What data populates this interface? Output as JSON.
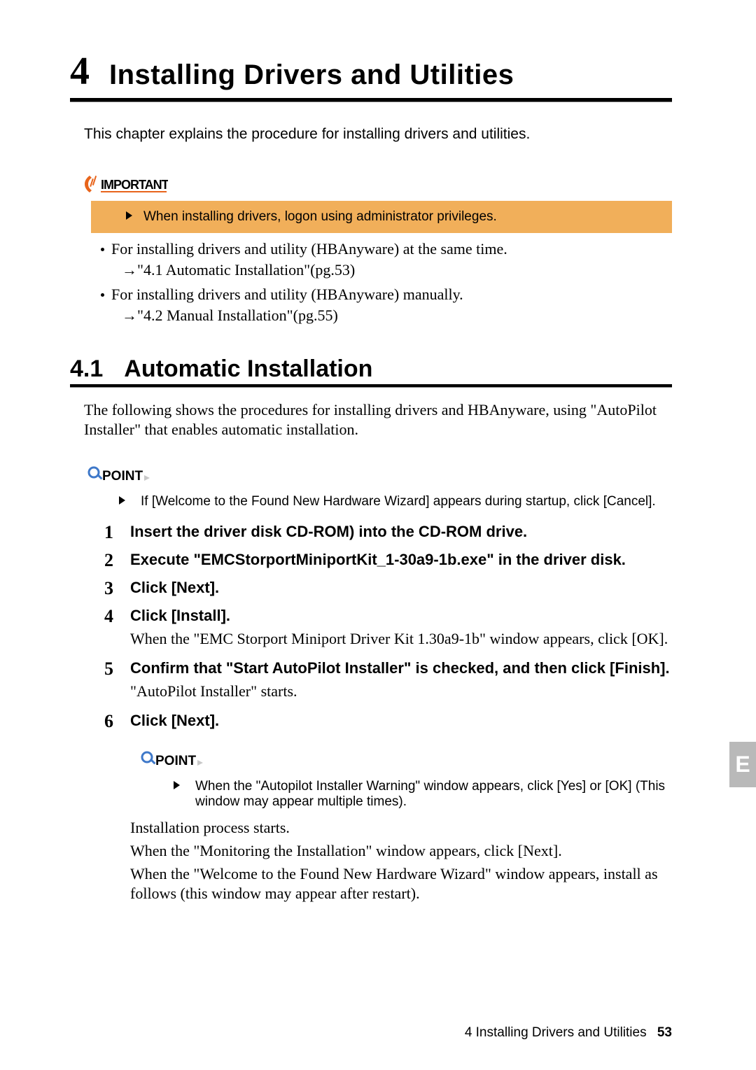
{
  "chapter": {
    "number": "4",
    "title": "Installing Drivers and Utilities",
    "description": "This chapter explains the procedure for installing drivers and utilities."
  },
  "important": {
    "label": "IMPORTANT",
    "text": "When installing drivers, logon using administrator privileges."
  },
  "notes": {
    "n1_line1": "For installing drivers and utility (HBAnyware) at the same time.",
    "n1_line2": "→\"4.1 Automatic Installation\"(pg.53)",
    "n2_line1": "For installing drivers and utility (HBAnyware) manually.",
    "n2_line2": "→\"4.2 Manual Installation\"(pg.55)"
  },
  "section": {
    "number": "4.1",
    "title": "Automatic Installation",
    "description": "The following shows the procedures for installing drivers and HBAnyware, using \"AutoPilot Installer\" that enables automatic installation."
  },
  "point1": {
    "label": "POINT",
    "text": "If [Welcome to the Found New Hardware Wizard] appears during startup, click [Cancel]."
  },
  "steps": {
    "s1": {
      "n": "1",
      "text": "Insert the driver disk CD-ROM) into the CD-ROM drive."
    },
    "s2": {
      "n": "2",
      "text": "Execute \"EMCStorportMiniportKit_1-30a9-1b.exe\" in the driver disk."
    },
    "s3": {
      "n": "3",
      "text": "Click [Next]."
    },
    "s4": {
      "n": "4",
      "text": "Click [Install].",
      "sub": "When the \"EMC Storport Miniport Driver Kit 1.30a9-1b\" window appears, click [OK]."
    },
    "s5": {
      "n": "5",
      "text": "Confirm that \"Start AutoPilot Installer\" is checked, and then click [Finish].",
      "sub": "\"AutoPilot Installer\" starts."
    },
    "s6": {
      "n": "6",
      "text": "Click [Next]."
    }
  },
  "point2": {
    "label": "POINT",
    "text": "When the \"Autopilot Installer Warning\" window appears, click [Yes] or [OK] (This window may appear multiple times)."
  },
  "after_point2": {
    "l1": "Installation process starts.",
    "l2": "When the \"Monitoring the Installation\" window appears, click [Next].",
    "l3": "When the \"Welcome to the Found New Hardware Wizard\" window appears, install as follows (this window may appear after restart)."
  },
  "side_tab": "E",
  "footer": {
    "label": "4  Installing Drivers and Utilities",
    "page": "53"
  }
}
